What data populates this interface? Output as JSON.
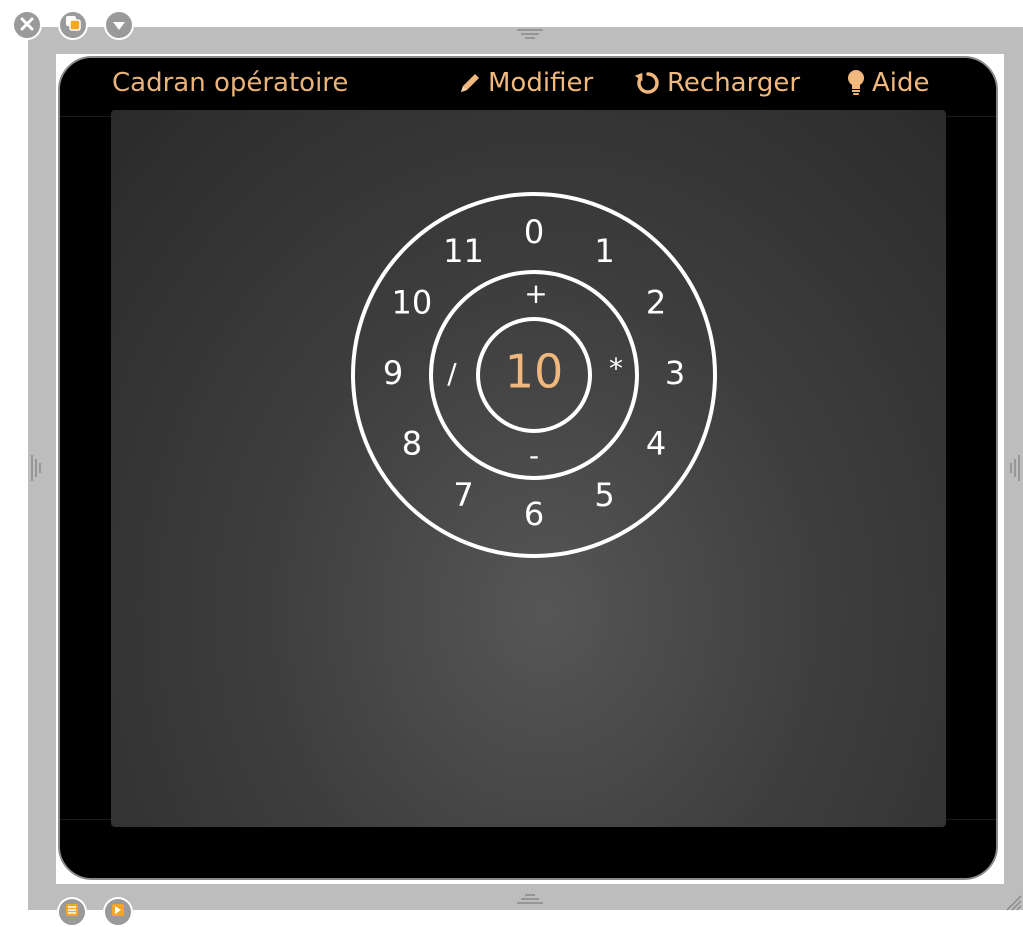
{
  "widget": {
    "title": "Cadran opératoire",
    "toolbar": {
      "modifier": "Modifier",
      "recharger": "Recharger",
      "aide": "Aide"
    }
  },
  "dial": {
    "numbers": [
      "0",
      "1",
      "2",
      "3",
      "4",
      "5",
      "6",
      "7",
      "8",
      "9",
      "10",
      "11"
    ],
    "operators": {
      "top": "+",
      "right": "*",
      "bottom": "-",
      "left": "/"
    },
    "center_value": "10"
  },
  "colors": {
    "accent": "#f0b87c",
    "frame": "#bdbdbd",
    "icon_badge": "#f5a623"
  },
  "icons": {
    "close": "close-icon",
    "duplicate": "duplicate-icon",
    "menu": "chevron-down-icon",
    "layer_down": "layer-down-icon",
    "layer_up": "layer-up-icon"
  }
}
